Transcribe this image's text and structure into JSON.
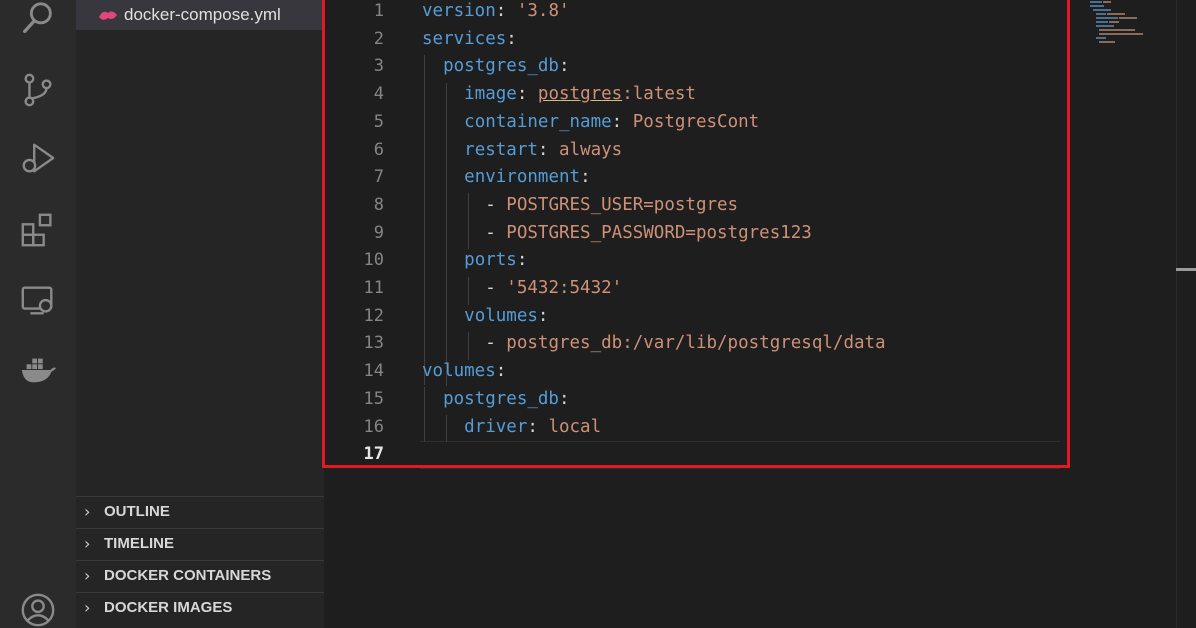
{
  "explorer": {
    "file_name": "docker-compose.yml"
  },
  "activity_bar": {
    "icons": [
      "search-icon",
      "source-control-icon",
      "run-debug-icon",
      "extensions-icon",
      "remote-explorer-icon",
      "docker-icon",
      "account-icon"
    ]
  },
  "panels": [
    {
      "title": "OUTLINE"
    },
    {
      "title": "TIMELINE"
    },
    {
      "title": "DOCKER CONTAINERS"
    },
    {
      "title": "DOCKER IMAGES"
    }
  ],
  "editor": {
    "language": "yaml",
    "active_line": 17,
    "lines": [
      {
        "num": "1",
        "indent": "",
        "key": "version",
        "sep": ": ",
        "value": "'3.8'"
      },
      {
        "num": "2",
        "indent": "",
        "key": "services",
        "sep": ":",
        "value": ""
      },
      {
        "num": "3",
        "indent": "  ",
        "key": "postgres_db",
        "sep": ":",
        "value": ""
      },
      {
        "num": "4",
        "indent": "    ",
        "key": "image",
        "sep": ": ",
        "value_underlined": "postgres",
        "value": ":latest"
      },
      {
        "num": "5",
        "indent": "    ",
        "key": "container_name",
        "sep": ": ",
        "value": "PostgresCont"
      },
      {
        "num": "6",
        "indent": "    ",
        "key": "restart",
        "sep": ": ",
        "value": "always"
      },
      {
        "num": "7",
        "indent": "    ",
        "key": "environment",
        "sep": ":",
        "value": ""
      },
      {
        "num": "8",
        "indent": "      ",
        "dash": "- ",
        "value": "POSTGRES_USER=postgres"
      },
      {
        "num": "9",
        "indent": "      ",
        "dash": "- ",
        "value": "POSTGRES_PASSWORD=postgres123"
      },
      {
        "num": "10",
        "indent": "    ",
        "key": "ports",
        "sep": ":",
        "value": ""
      },
      {
        "num": "11",
        "indent": "      ",
        "dash": "- ",
        "value": "'5432:5432'"
      },
      {
        "num": "12",
        "indent": "    ",
        "key": "volumes",
        "sep": ":",
        "value": ""
      },
      {
        "num": "13",
        "indent": "      ",
        "dash": "- ",
        "value": "postgres_db:/var/lib/postgresql/data"
      },
      {
        "num": "14",
        "indent": "",
        "key": "volumes",
        "sep": ":",
        "value": ""
      },
      {
        "num": "15",
        "indent": "  ",
        "key": "postgres_db",
        "sep": ":",
        "value": ""
      },
      {
        "num": "16",
        "indent": "    ",
        "key": "driver",
        "sep": ": ",
        "value": "local"
      },
      {
        "num": "17",
        "indent": "",
        "key": "",
        "sep": "",
        "value": ""
      }
    ]
  },
  "colors": {
    "key": "#569cd6",
    "string": "#ce9178",
    "punctuation": "#d4d4d4",
    "highlight_box": "#e01a22"
  }
}
